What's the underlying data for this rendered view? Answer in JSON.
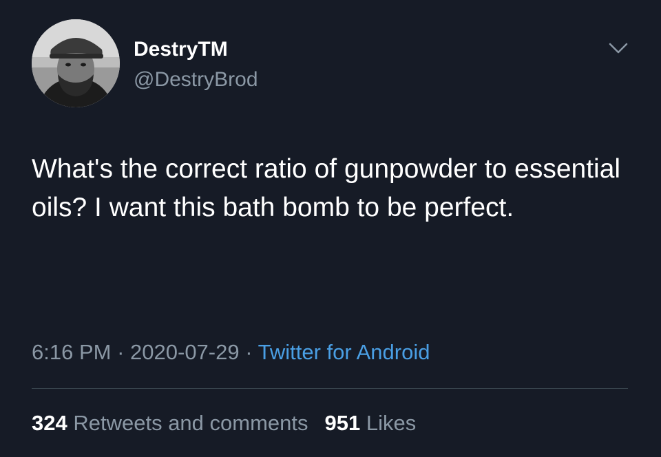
{
  "user": {
    "display_name": "DestryTM",
    "handle": "@DestryBrod",
    "avatar_icon": "user-avatar-photo"
  },
  "tweet": {
    "text": "What's the correct ratio of gunpowder to essential oils? I want this bath bomb to be perfect.",
    "time": "6:16 PM",
    "separator": "·",
    "date": "2020-07-29",
    "source": "Twitter for Android"
  },
  "stats": {
    "retweets_count": "324",
    "retweets_label": "Retweets and comments",
    "likes_count": "951",
    "likes_label": "Likes"
  },
  "colors": {
    "background": "#161b26",
    "text": "#ffffff",
    "secondary_text": "#8b98a5",
    "link": "#4a9fe4",
    "divider": "#38444d"
  },
  "icons": {
    "menu_caret": "chevron-down-icon"
  }
}
